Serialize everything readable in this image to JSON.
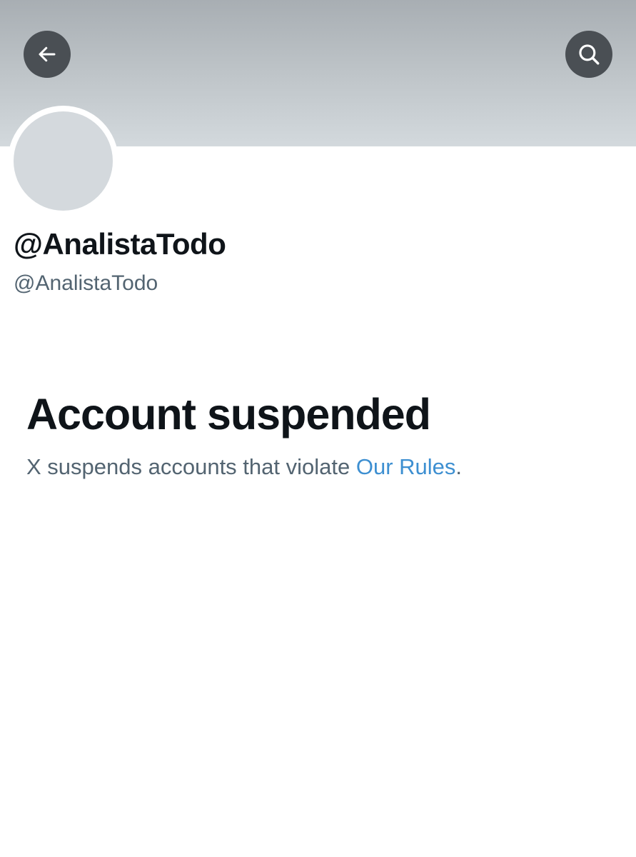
{
  "header": {
    "back_icon": "arrow-left-icon",
    "search_icon": "search-icon",
    "button_color": "#4a4f54"
  },
  "profile": {
    "display_name": "@AnalistaTodo",
    "handle": "@AnalistaTodo"
  },
  "notice": {
    "title": "Account suspended",
    "message_prefix": "X suspends accounts that violate ",
    "link_text": "Our Rules",
    "message_suffix": ".",
    "link_color": "#3d8fd1"
  }
}
